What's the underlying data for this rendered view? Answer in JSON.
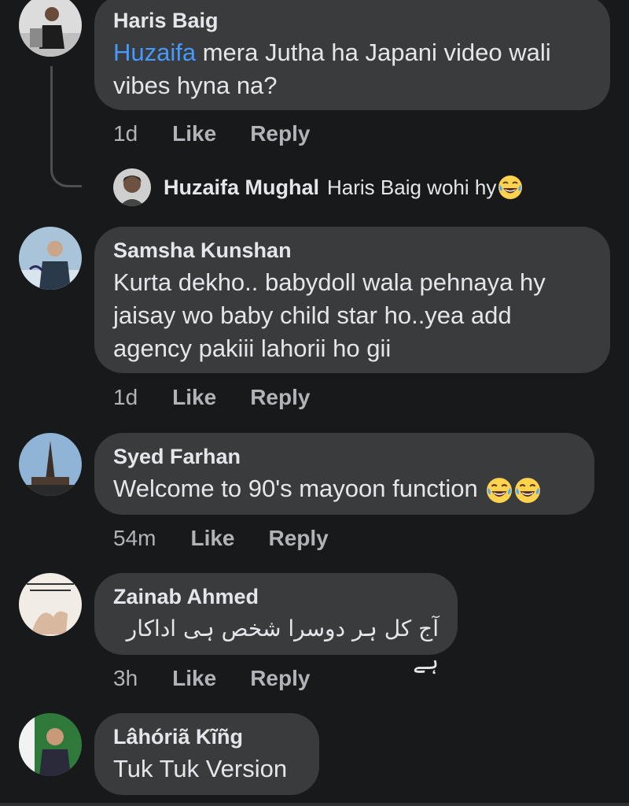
{
  "comments": [
    {
      "name": "Haris Baig",
      "mention": "Huzaifa",
      "text_line1": " mera Jutha ha Japani video wali",
      "text_line2": "vibes hyna na?",
      "time": "1d",
      "like": "Like",
      "reply": "Reply",
      "nested_reply": {
        "name": "Huzaifa Mughal",
        "text": "Haris Baig wohi hy",
        "emoji": "face-with-tears-of-joy"
      }
    },
    {
      "name": "Samsha Kunshan",
      "text_line1": "Kurta dekho.. babydoll wala pehnaya hy",
      "text_line2": "jaisay wo baby child star ho..yea add",
      "text_line3": "agency pakiii lahorii ho gii",
      "time": "1d",
      "like": "Like",
      "reply": "Reply"
    },
    {
      "name": "Syed Farhan",
      "text": "Welcome to 90's mayoon function ",
      "emoji": "face-with-tears-of-joy",
      "time": "54m",
      "like": "Like",
      "reply": "Reply"
    },
    {
      "name": "Zainab Ahmed",
      "text": "آج کل ہر دوسرا شخص ہی اداکار ہے",
      "time": "3h",
      "like": "Like",
      "reply": "Reply"
    },
    {
      "name": "Lâhóriã Kĩñg",
      "text": "Tuk Tuk Version"
    }
  ],
  "colors": {
    "background": "#18191a",
    "bubble": "#3a3b3c",
    "text": "#e4e6eb",
    "secondary": "#b0b3b8",
    "mention": "#4599ff"
  }
}
